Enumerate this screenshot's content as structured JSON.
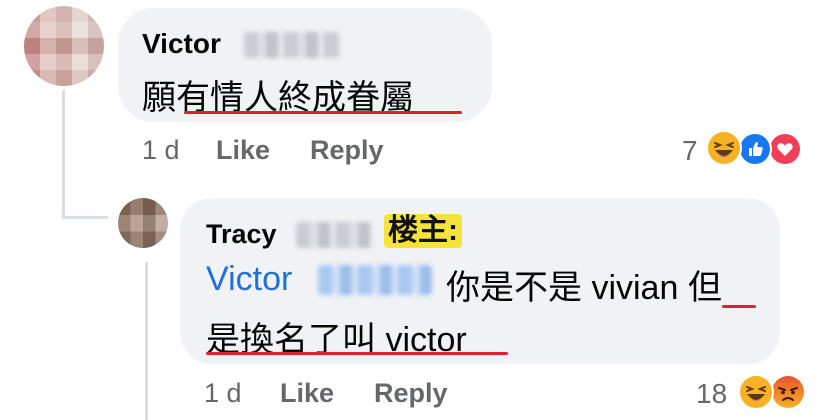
{
  "comments": [
    {
      "author": "Victor",
      "text": "願有情人終成眷屬",
      "time": "1 d",
      "like_label": "Like",
      "reply_label": "Reply",
      "reaction_count": "7",
      "reactions": [
        "haha-icon",
        "like-icon",
        "love-icon"
      ]
    },
    {
      "author": "Tracy",
      "owner_tag": "楼主:",
      "mention": "Victor",
      "text_line1": "你是不是 vivian 但",
      "text_line2": "是換名了叫 victor",
      "time": "1 d",
      "like_label": "Like",
      "reply_label": "Reply",
      "reaction_count": "18",
      "reactions": [
        "haha-icon",
        "angry-icon"
      ]
    }
  ],
  "colors": {
    "bubble": "#f0f2f5",
    "mention": "#216fdb",
    "meta": "#65676b",
    "highlight": "#f6e33a",
    "underline": "#e0202a"
  }
}
